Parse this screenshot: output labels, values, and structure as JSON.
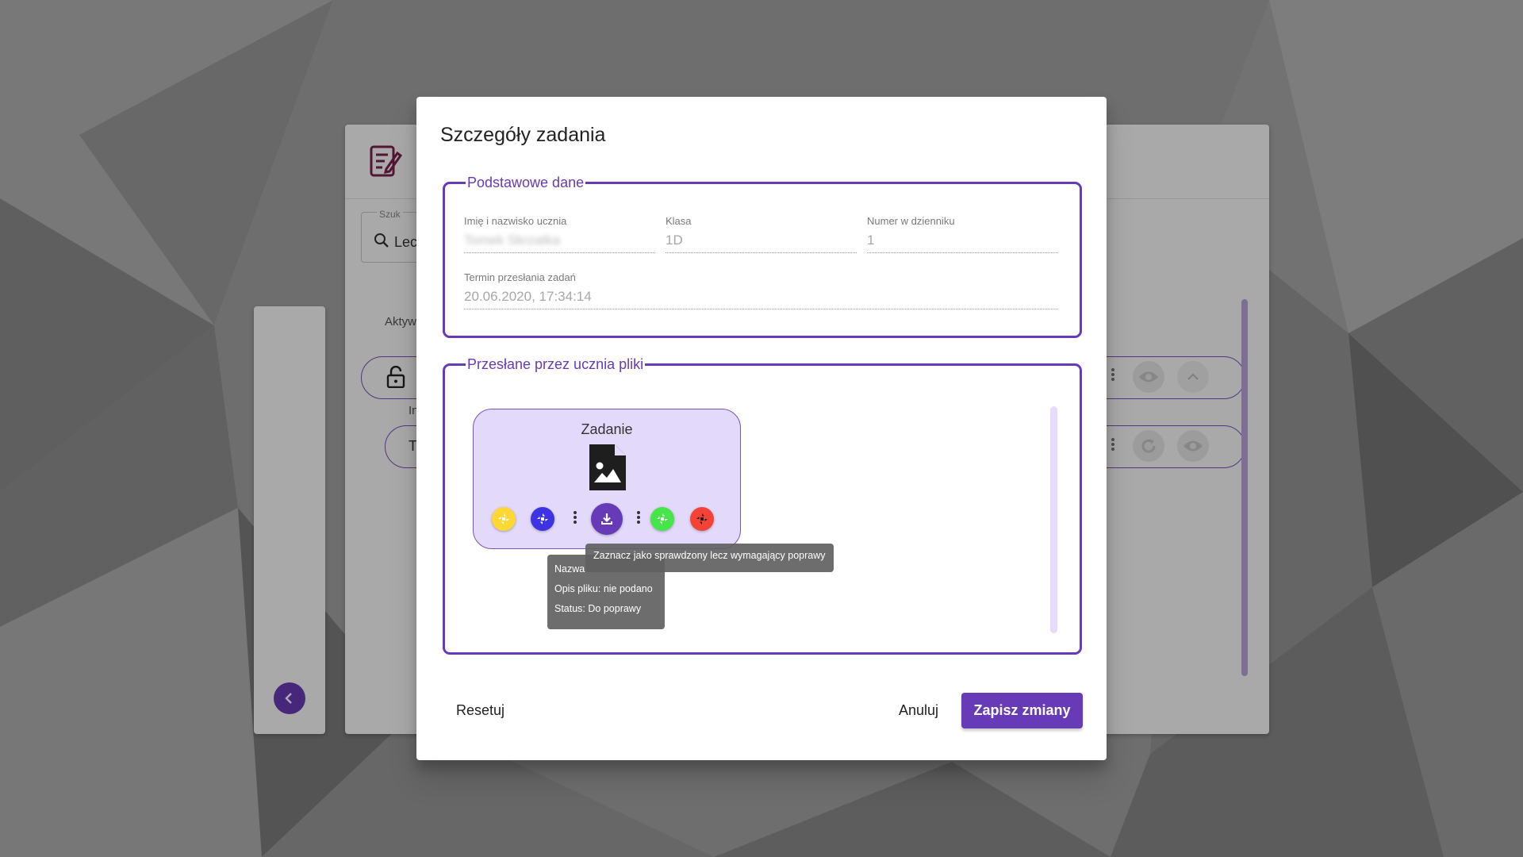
{
  "background_app": {
    "search": {
      "label": "Szuk",
      "value": "Lec"
    },
    "tab_label": "Aktyw",
    "row_label_2": "In",
    "row_text": "T"
  },
  "dialog": {
    "title": "Szczegóły zadania",
    "basic": {
      "legend": "Podstawowe dane",
      "student_name": {
        "label": "Imię i nazwisko ucznia",
        "value": "Tomek Skrzatka"
      },
      "class": {
        "label": "Klasa",
        "value": "1D"
      },
      "journal_number": {
        "label": "Numer w dzienniku",
        "value": "1"
      },
      "deadline": {
        "label": "Termin przesłania zadań",
        "value": "20.06.2020, 17:34:14"
      }
    },
    "files": {
      "legend": "Przesłane przez ucznia pliki",
      "card": {
        "title": "Zadanie",
        "file_icon": "image-file-icon",
        "actions": [
          {
            "name": "mark-yellow-icon",
            "color": "#fdd835"
          },
          {
            "name": "mark-blue-icon",
            "color": "#3d33e3"
          },
          {
            "name": "download-icon",
            "color": "#673ab7"
          },
          {
            "name": "mark-green-icon",
            "color": "#46e64a"
          },
          {
            "name": "mark-red-icon",
            "color": "#f44336"
          }
        ]
      }
    },
    "tooltip_info": {
      "name_line": "Nazwa",
      "description_line": "Opis pliku: nie podano",
      "status_line": "Status: Do poprawy"
    },
    "tooltip_action": "Zaznacz jako sprawdzony lecz wymagający poprawy",
    "buttons": {
      "reset": "Resetuj",
      "cancel": "Anuluj",
      "save": "Zapisz zmiany"
    }
  },
  "colors": {
    "primary": "#673ab7",
    "card_bg": "#e3dafb"
  }
}
